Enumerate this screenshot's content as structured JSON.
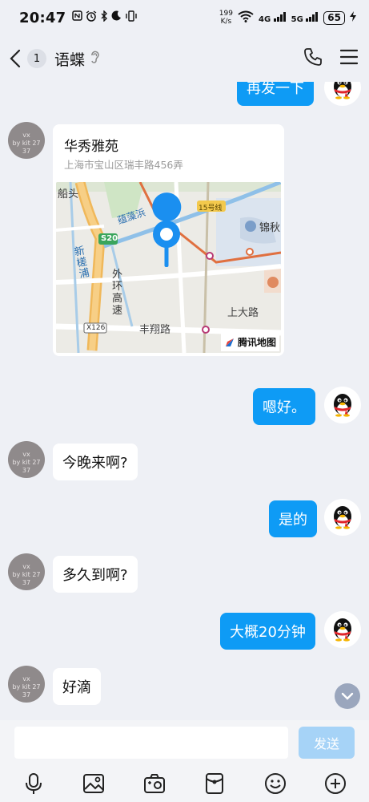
{
  "status_bar": {
    "time": "20:47",
    "net_speed_value": "199",
    "net_speed_unit": "K/s",
    "signal1": "4G",
    "signal2": "5G",
    "battery": "65"
  },
  "nav": {
    "unread_count": "1",
    "contact_name": "语蝶"
  },
  "messages": {
    "top_partial": "再发一下",
    "location": {
      "title": "华秀雅苑",
      "address": "上海市宝山区瑞丰路456弄",
      "map_labels": {
        "chuantou": "船头",
        "wenzaobang": "蕴藻浜",
        "line15": "15号线",
        "jin": "锦秋",
        "s20": "S20",
        "xinchuanpu": "新槎浦",
        "waihuan": "外环高速",
        "shangda": "上大路",
        "x126": "X126",
        "fengxiang": "丰翔路"
      },
      "map_provider": "腾讯地图"
    },
    "m1": "嗯好。",
    "m2": "今晚来啊?",
    "m3": "是的",
    "m4": "多久到啊?",
    "m5": "大概20分钟",
    "m6": "好滴"
  },
  "friend_avatar_text": [
    "vx",
    "by kit 27 37"
  ],
  "input": {
    "placeholder": "",
    "send_label": "发送"
  },
  "colors": {
    "accent": "#0e9bf5",
    "send_disabled": "#a6d3f7",
    "background": "#eef0f5"
  },
  "toolbar_icons": [
    "mic-icon",
    "image-icon",
    "camera-icon",
    "red-packet-icon",
    "emoji-icon",
    "plus-icon"
  ]
}
